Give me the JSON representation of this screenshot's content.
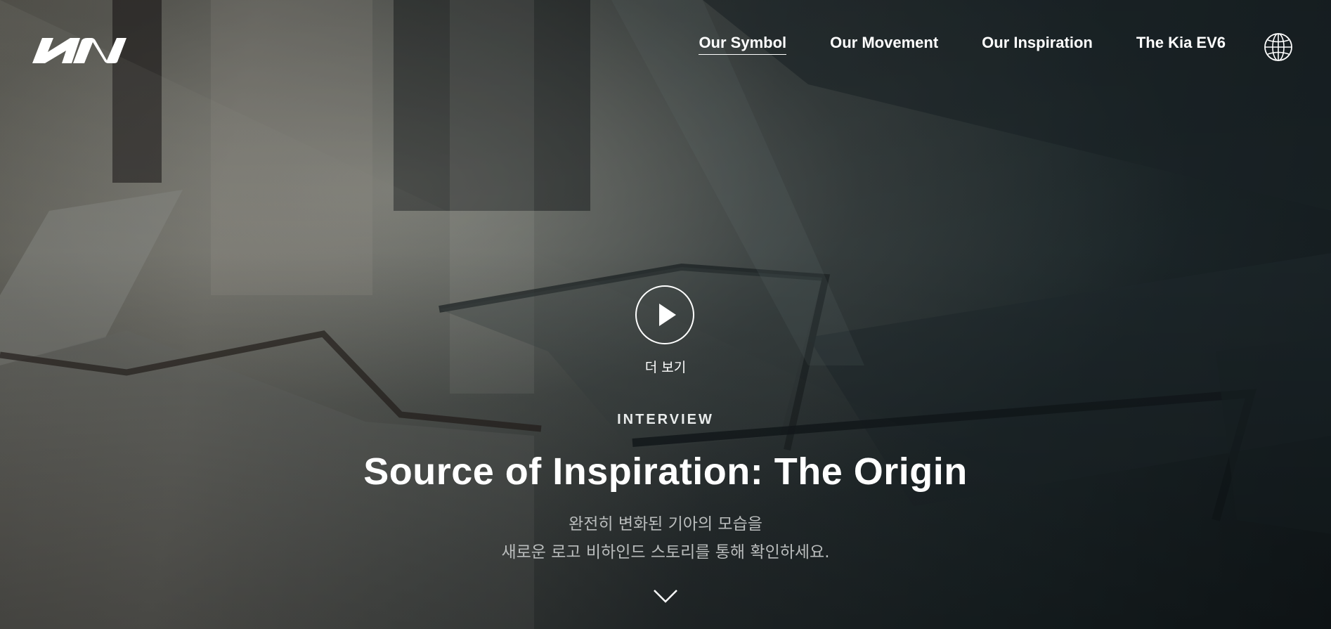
{
  "brand": {
    "logo_text": "KIA"
  },
  "nav": {
    "items": [
      {
        "label": "Our Symbol",
        "active": true
      },
      {
        "label": "Our Movement",
        "active": false
      },
      {
        "label": "Our Inspiration",
        "active": false
      },
      {
        "label": "The Kia EV6",
        "active": false
      }
    ],
    "language_icon": "globe-icon"
  },
  "hero": {
    "play_icon": "play-icon",
    "more_label": "더 보기",
    "category": "INTERVIEW",
    "title": "Source of Inspiration: The Origin",
    "description_line1": "완전히 변화된 기아의 모습을",
    "description_line2": "새로운 로고 비하인드 스토리를 통해 확인하세요.",
    "scroll_icon": "chevron-down-icon"
  },
  "colors": {
    "text_primary": "#ffffff",
    "text_secondary": "#b9bcbc",
    "background_dark": "#1d2326"
  }
}
